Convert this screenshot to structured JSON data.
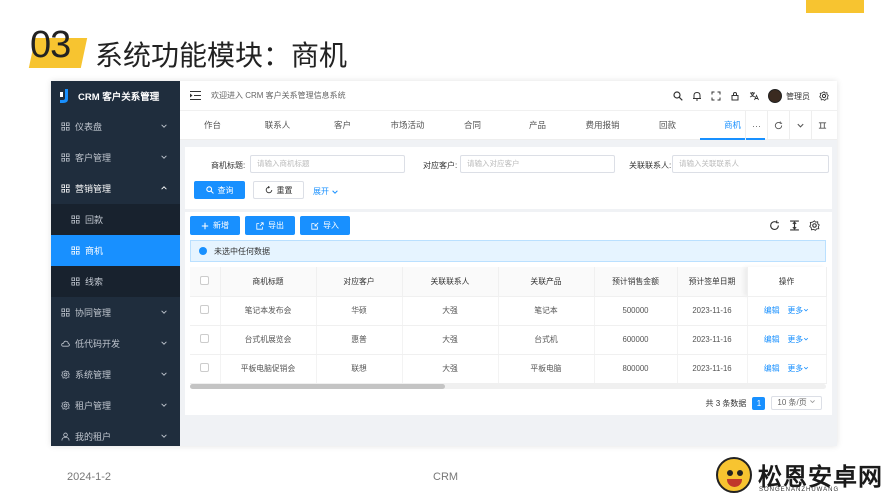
{
  "slide": {
    "number": "03",
    "title": "系统功能模块：商机",
    "footer_date": "2024-1-2",
    "footer_center": "CRM"
  },
  "watermark": {
    "main": "松恩安卓网",
    "sub": "SONGENANZHUWANG"
  },
  "colors": {
    "accent_yellow": "#f7c430",
    "primary_blue": "#1890ff",
    "sidebar_bg": "#1f2d3d"
  },
  "sidebar": {
    "brand": "CRM 客户关系管理",
    "items": [
      {
        "label": "仪表盘",
        "icon": "grid-icon",
        "chevron": "down"
      },
      {
        "label": "客户管理",
        "icon": "grid-icon",
        "chevron": "down"
      },
      {
        "label": "营销管理",
        "icon": "grid-icon",
        "chevron": "up"
      },
      {
        "label": "回款",
        "icon": "grid-icon",
        "sub": true
      },
      {
        "label": "商机",
        "icon": "grid-icon",
        "sub": true,
        "active": true
      },
      {
        "label": "线索",
        "icon": "grid-icon",
        "sub": true
      },
      {
        "label": "协同管理",
        "icon": "grid-icon",
        "chevron": "down"
      },
      {
        "label": "低代码开发",
        "icon": "cloud-icon",
        "chevron": "down"
      },
      {
        "label": "系统管理",
        "icon": "gear-icon",
        "chevron": "down"
      },
      {
        "label": "租户管理",
        "icon": "gear-icon",
        "chevron": "down"
      },
      {
        "label": "我的租户",
        "icon": "user-icon",
        "chevron": "down"
      }
    ]
  },
  "topbar": {
    "welcome": "欢迎进入 CRM 客户关系管理信息系统",
    "username": "管理员"
  },
  "tabs": [
    "作台",
    "联系人",
    "客户",
    "市场活动",
    "合同",
    "产品",
    "费用报销",
    "回款",
    "商机"
  ],
  "active_tab": "商机",
  "search": {
    "title_label": "商机标题:",
    "title_placeholder": "请输入商机标题",
    "customer_label": "对应客户:",
    "customer_placeholder": "请输入对应客户",
    "contact_label": "关联联系人:",
    "contact_placeholder": "请输入关联联系人",
    "query": "查询",
    "reset": "重置",
    "expand": "展开"
  },
  "toolbar": {
    "add": "新增",
    "export": "导出",
    "import": "导入"
  },
  "alert": "未选中任何数据",
  "table": {
    "headers": [
      "商机标题",
      "对应客户",
      "关联联系人",
      "关联产品",
      "预计销售金额",
      "预计签单日期",
      "操作"
    ],
    "rows": [
      [
        "笔记本发布会",
        "华硕",
        "大强",
        "笔记本",
        "500000",
        "2023-11-16"
      ],
      [
        "台式机展览会",
        "惠普",
        "大强",
        "台式机",
        "600000",
        "2023-11-16"
      ],
      [
        "平板电脑促销会",
        "联想",
        "大强",
        "平板电脑",
        "800000",
        "2023-11-16"
      ]
    ],
    "edit": "编辑",
    "more": "更多"
  },
  "pager": {
    "total": "共 3 条数据",
    "page": "1",
    "size": "10 条/页"
  }
}
